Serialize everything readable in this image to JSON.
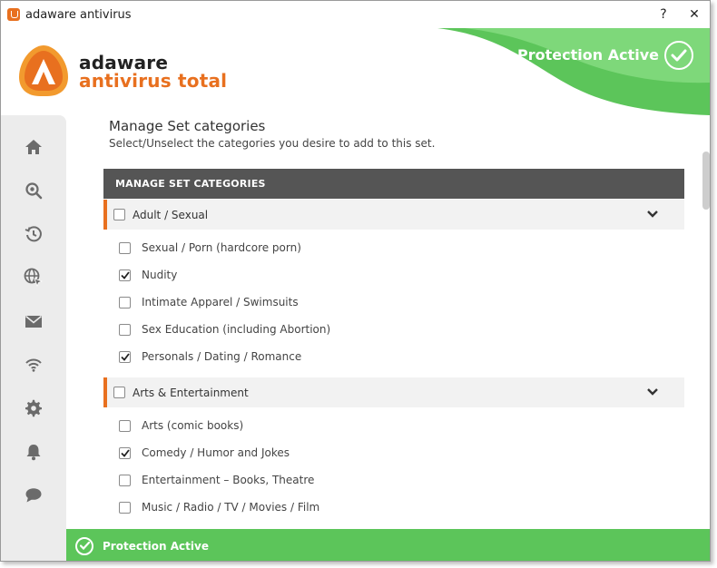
{
  "window": {
    "title": "adaware antivirus",
    "help": "?",
    "close": "✕"
  },
  "brand": {
    "line1": "adaware",
    "line2": "antivirus total"
  },
  "header": {
    "status": "Protection Active"
  },
  "colors": {
    "accent": "#e8701f",
    "green": "#5cc55a",
    "table_header": "#555555"
  },
  "sidebar": {
    "items": [
      {
        "icon": "home-icon"
      },
      {
        "icon": "scan-icon"
      },
      {
        "icon": "history-icon"
      },
      {
        "icon": "web-protection-icon"
      },
      {
        "icon": "email-icon"
      },
      {
        "icon": "wifi-icon"
      },
      {
        "icon": "settings-icon"
      },
      {
        "icon": "notifications-icon"
      },
      {
        "icon": "chat-icon"
      }
    ]
  },
  "main": {
    "title": "Manage Set categories",
    "subtitle": "Select/Unselect the categories you desire to add to this set.",
    "table_header": "MANAGE SET CATEGORIES",
    "groups": [
      {
        "label": "Adult / Sexual",
        "checked": false,
        "items": [
          {
            "label": "Sexual / Porn (hardcore porn)",
            "checked": false
          },
          {
            "label": "Nudity",
            "checked": true
          },
          {
            "label": "Intimate Apparel / Swimsuits",
            "checked": false
          },
          {
            "label": "Sex Education (including Abortion)",
            "checked": false
          },
          {
            "label": "Personals / Dating / Romance",
            "checked": true
          }
        ]
      },
      {
        "label": "Arts & Entertainment",
        "checked": false,
        "items": [
          {
            "label": "Arts (comic books)",
            "checked": false
          },
          {
            "label": "Comedy / Humor and Jokes",
            "checked": true
          },
          {
            "label": "Entertainment – Books, Theatre",
            "checked": false
          },
          {
            "label": "Music / Radio / TV / Movies / Film",
            "checked": false
          }
        ]
      }
    ]
  },
  "footer": {
    "status": "Protection Active"
  }
}
